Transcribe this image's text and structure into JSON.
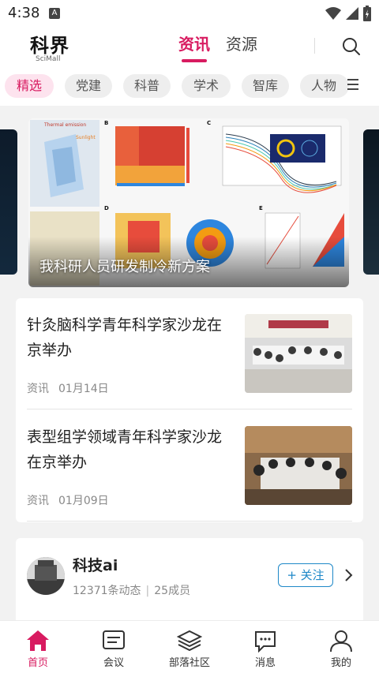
{
  "status_bar": {
    "time": "4:38",
    "notif_badge": "A"
  },
  "header": {
    "logo_text": "科界",
    "logo_sub": "SciMall",
    "tabs": [
      {
        "label": "资讯",
        "active": true
      },
      {
        "label": "资源",
        "active": false
      }
    ]
  },
  "categories": [
    {
      "label": "精选",
      "active": true
    },
    {
      "label": "党建",
      "active": false
    },
    {
      "label": "科普",
      "active": false
    },
    {
      "label": "学术",
      "active": false
    },
    {
      "label": "智库",
      "active": false
    },
    {
      "label": "人物",
      "active": false
    }
  ],
  "banner": {
    "caption": "我科研人员研发制冷新方案"
  },
  "news": [
    {
      "title": "针灸脑科学青年科学家沙龙在京举办",
      "source": "资讯",
      "date": "01月14日",
      "thumb_caption": ""
    },
    {
      "title": "表型组学领域青年科学家沙龙在京举办",
      "source": "资讯",
      "date": "01月09日"
    }
  ],
  "community": {
    "name": "科技ai",
    "activity": "12371条动态",
    "members": "25成员",
    "follow_label": "+ 关注"
  },
  "bottom_nav": [
    {
      "label": "首页",
      "active": true
    },
    {
      "label": "会议",
      "active": false
    },
    {
      "label": "部落社区",
      "active": false
    },
    {
      "label": "消息",
      "active": false
    },
    {
      "label": "我的",
      "active": false
    }
  ],
  "colors": {
    "accent": "#d81b60",
    "follow": "#1e88c8"
  }
}
